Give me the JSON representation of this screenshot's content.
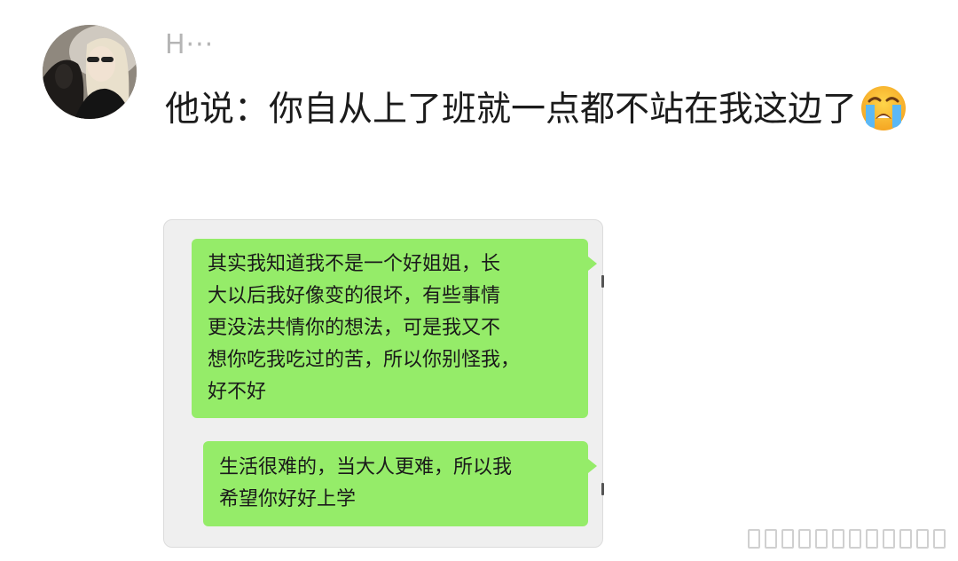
{
  "post": {
    "author": "H···",
    "text": "他说：你自从上了班就一点都不站在我这边了",
    "emoji": "loudly-crying-face-icon"
  },
  "chat_screenshot": {
    "messages": [
      {
        "side": "right",
        "lines": [
          "其实我知道我不是一个好姐姐，长",
          "大以后我好像变的很坏，有些事情",
          "更没法共情你的想法，可是我又不",
          "想你吃我吃过的苦，所以你别怪我，",
          "好不好"
        ]
      },
      {
        "side": "right",
        "lines": [
          "生活很难的，当大人更难，所以我",
          "希望你好好上学"
        ]
      }
    ]
  },
  "colors": {
    "bubble": "#95ec69",
    "chat_background": "#efefef",
    "username": "#b5b5b5",
    "text": "#1b1b1b"
  }
}
